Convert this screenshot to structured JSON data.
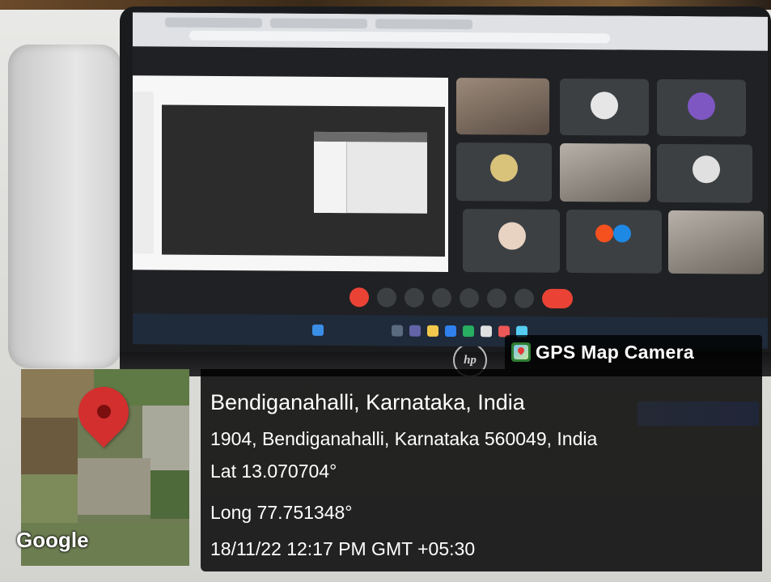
{
  "gps_overlay": {
    "brand": "GPS Map Camera",
    "brand_icon": "gps-map-camera-app-icon",
    "map_attribution": "Google",
    "location_title": "Bendiganahalli, Karnataka, India",
    "address": "1904, Bendiganahalli, Karnataka 560049, India",
    "latitude": "Lat 13.070704°",
    "longitude": "Long 77.751348°",
    "datetime": "18/11/22 12:17 PM GMT +05:30"
  },
  "colors": {
    "pin": "#d32f2f",
    "panel": "#000000",
    "meet_red": "#ea4335"
  }
}
